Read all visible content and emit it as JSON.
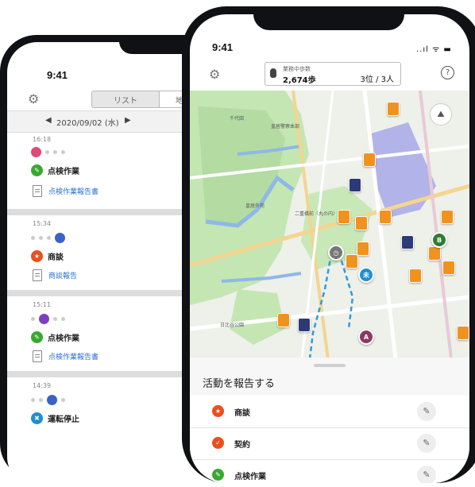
{
  "back_phone": {
    "status_time": "9:41",
    "tabs": {
      "list": "リスト",
      "map": "地図"
    },
    "date": {
      "prev": "◀",
      "value": "2020/09/02 (水)",
      "next": "▶"
    },
    "entries": [
      {
        "time": "16:18",
        "activity": "点検作業",
        "report": "点検作業報告書",
        "color": "#39a832"
      },
      {
        "time": "15:34",
        "activity": "商談",
        "report": "商談報告",
        "color": "#e8501c"
      },
      {
        "time": "15:11",
        "activity": "点検作業",
        "report": "点検作業報告書",
        "color": "#39a832"
      },
      {
        "time": "14:39",
        "activity": "運転停止",
        "color": "#1f8fd0"
      }
    ]
  },
  "front_phone": {
    "status_time": "9:41",
    "status_icons": "..ıl ᯤ ▬",
    "steps": {
      "label": "業務中歩数",
      "value": "2,674歩",
      "rank": "3位 / 3人"
    },
    "help_label": "?",
    "map_labels": [
      "千代田",
      "皇居警察本部",
      "皇居外苑",
      "二重橋前〈丸の内〉",
      "日比谷公園"
    ],
    "markers": [
      {
        "text": "未",
        "color": "#1f8fd0"
      },
      {
        "text": "B",
        "color": "#2e7d32"
      },
      {
        "text": "A",
        "color": "#8b3a62"
      }
    ],
    "sheet": {
      "title": "活動を報告する",
      "items": [
        {
          "label": "商談",
          "color": "#e8501c"
        },
        {
          "label": "契約",
          "color": "#e8501c"
        },
        {
          "label": "点検作業",
          "color": "#39a832"
        }
      ]
    }
  },
  "colors": {
    "pin_orange": "#f0921e",
    "pin_navy": "#2c3a78",
    "marker_purple": "#7e3fc4",
    "route_blue": "#2f9ae0"
  }
}
